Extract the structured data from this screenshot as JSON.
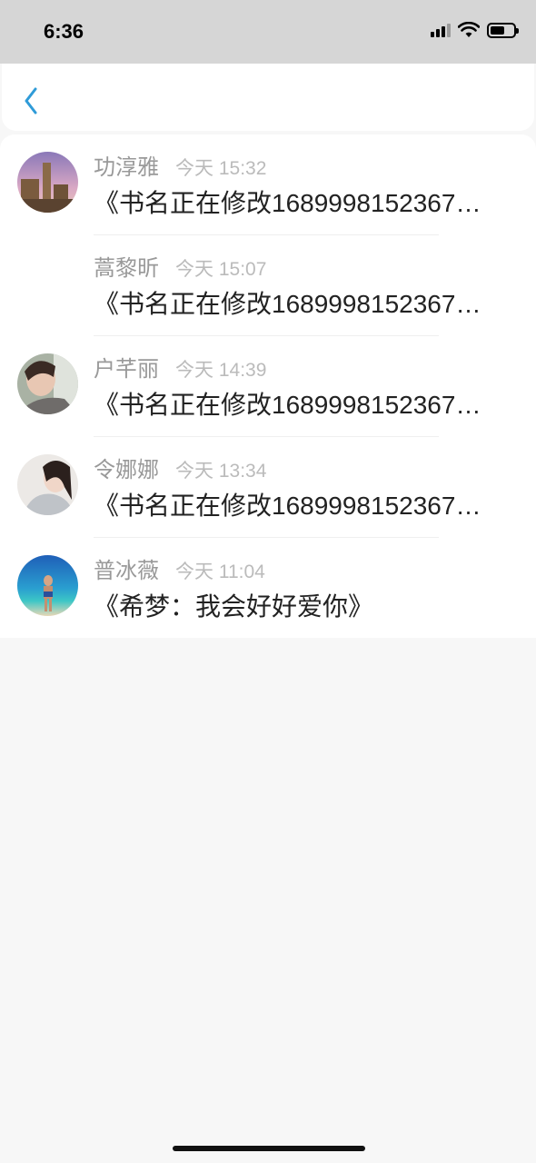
{
  "status_bar": {
    "time": "6:36",
    "icons": [
      "signal-icon",
      "wifi-icon",
      "battery-icon"
    ]
  },
  "nav": {
    "back_icon": "chevron-left-icon",
    "accent_color": "#2f9bd8"
  },
  "messages": [
    {
      "name": "功淳雅",
      "time": "今天 15:32",
      "text": "《书名正在修改1689998152367…",
      "avatar": "avatar-cathedral"
    },
    {
      "name": "蒿黎昕",
      "time": "今天 15:07",
      "text": "《书名正在修改1689998152367…",
      "avatar": ""
    },
    {
      "name": "户芊丽",
      "time": "今天 14:39",
      "text": "《书名正在修改1689998152367…",
      "avatar": "avatar-portrait-woman"
    },
    {
      "name": "令娜娜",
      "time": "今天 13:34",
      "text": "《书名正在修改1689998152367…",
      "avatar": "avatar-portrait-girl"
    },
    {
      "name": "普冰薇",
      "time": "今天 11:04",
      "text": "《希梦：我会好好爱你》",
      "avatar": "avatar-beach"
    }
  ]
}
